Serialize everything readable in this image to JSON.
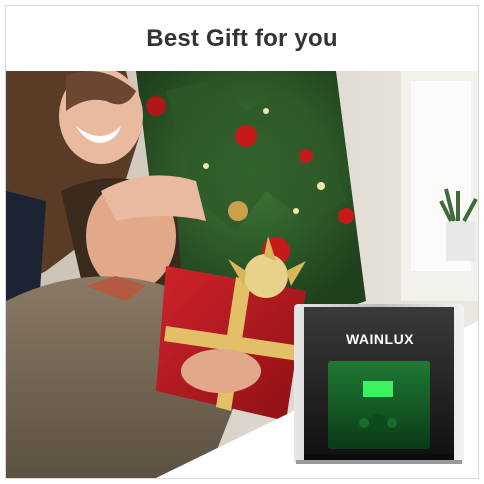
{
  "header": {
    "title": "Best Gift for you"
  },
  "product": {
    "brand": "WAINLUX"
  },
  "scene": {
    "photo": "couple-gift-christmas-tree",
    "icons": [
      "christmas-tree-icon",
      "gift-box-icon",
      "laser-engraver-icon"
    ]
  },
  "colors": {
    "accent": "#c41a1a",
    "tree": "#2e5a2a",
    "engraver-window": "#1d6a2e"
  }
}
